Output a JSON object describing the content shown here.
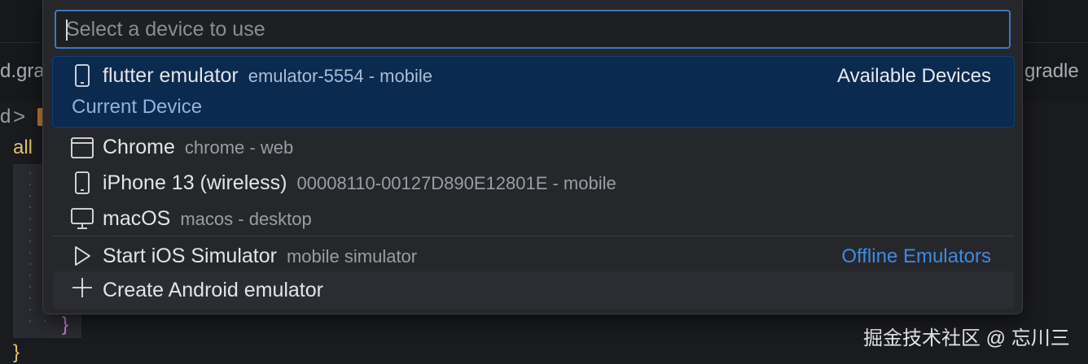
{
  "background": {
    "left_tab_text": "d.gra",
    "right_tab_text": "gradle",
    "crumb_text": "d",
    "crumb_chevron": ">",
    "code_text": "all",
    "brace_close": "}",
    "brace_bottom": "}"
  },
  "watermark": "掘金技术社区 @ 忘川三",
  "quick_pick": {
    "input": {
      "value": "",
      "placeholder": "Select a device to use"
    },
    "items": [
      {
        "icon": "device-mobile-icon",
        "label": "flutter emulator",
        "description": "emulator-5554 - mobile",
        "detail": "Current Device",
        "group": "Available Devices",
        "selected": true
      },
      {
        "icon": "browser-window-icon",
        "label": "Chrome",
        "description": "chrome - web"
      },
      {
        "icon": "device-mobile-icon",
        "label": "iPhone 13 (wireless)",
        "description": "00008110-00127D890E12801E - mobile"
      },
      {
        "icon": "desktop-monitor-icon",
        "label": "macOS",
        "description": "macos - desktop"
      },
      {
        "icon": "play-icon",
        "label": "Start iOS Simulator",
        "description": "mobile simulator",
        "group": "Offline Emulators"
      },
      {
        "icon": "plus-icon",
        "label": "Create Android emulator",
        "description": "",
        "hovered": true
      }
    ]
  },
  "colors": {
    "selection_bg": "#0a2a4f",
    "focus_border": "#3b79c2",
    "group_link": "#3f8ae0"
  }
}
